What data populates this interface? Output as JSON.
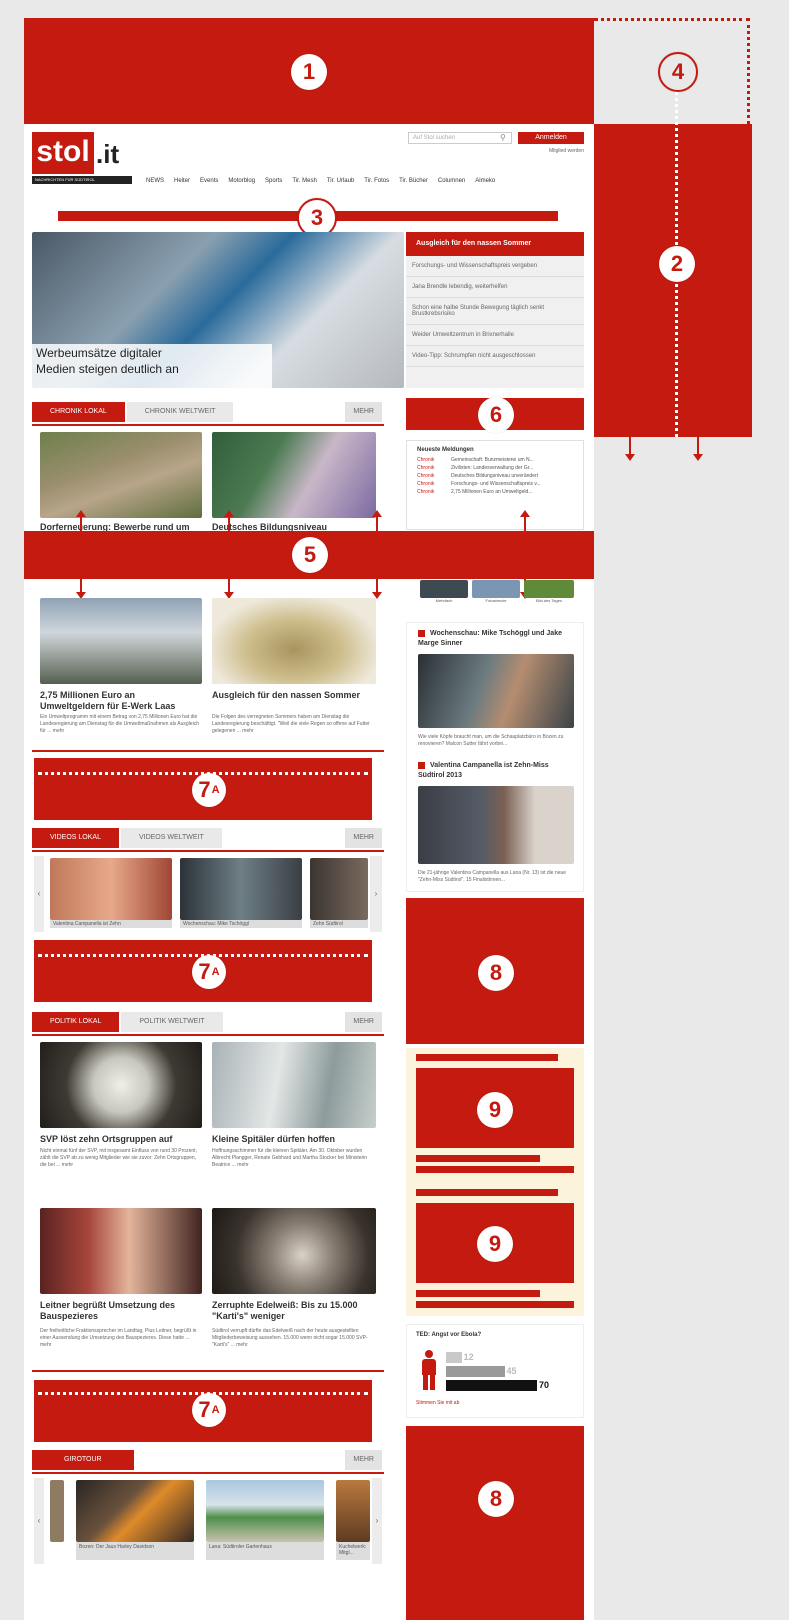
{
  "markers": {
    "m1": "1",
    "m2": "2",
    "m3": "3",
    "m4": "4",
    "m5": "5",
    "m6": "6",
    "m7a": "7",
    "m7a_sub": "A",
    "m8": "8",
    "m9": "9"
  },
  "logo": {
    "brand": "stol",
    "tld": ".it",
    "tagline": "NACHRICHTEN FÜR SÜDTIROL"
  },
  "header": {
    "search_placeholder": "Auf Stol suchen",
    "login_label": "Anmelden",
    "sub_link": "Mitglied werden"
  },
  "nav": [
    "NEWS",
    "Heiter",
    "Events",
    "Motorblog",
    "Sports",
    "Tir. Mesh",
    "Tir. Urlaub",
    "Tir. Fotos",
    "Tir. Bücher",
    "Columnen",
    "Almeko"
  ],
  "hero": {
    "caption_line1": "Werbeumsätze digitaler",
    "caption_line2": "Medien steigen deutlich an",
    "side_title": "Ausgleich für den nassen Sommer",
    "side_items": [
      "Forschungs- und Wissenschaftspreis vergeben",
      "Jana Brendle lebendig, weiterhelfen",
      "Schon eine halbe Stunde Bewegung täglich senkt Brustkrebsrisiko",
      "Weider Umweltzentrum in Brixnerhalle",
      "Video-Tipp: Schrumpfen nicht ausgeschlossen"
    ]
  },
  "section_chronik": {
    "tab_active": "CHRONIK LOKAL",
    "tab_inactive": "CHRONIK WELTWEIT",
    "more": "MEHR",
    "items": [
      {
        "headline": "Dorferneuerung: Bewerbe rund um",
        "teaser": ""
      },
      {
        "headline": "Deutsches Bildungsniveau unverändert",
        "teaser": ""
      },
      {
        "headline": "2,75 Millionen Euro an Umweltgeldern für E-Werk Laas",
        "teaser": "Ein Umweltprogramm mit einem Betrag von 2,75 Millionen Euro hat die Landesregierung am Dienstag für die Umweltmaßnahmen als Ausgleich für ... mehr"
      },
      {
        "headline": "Ausgleich für den nassen Sommer",
        "teaser": "Die Folgen des verregneten Sommers haben am Dienstag die Landesregierung beschäftigt. \"Weil die viele Regen so offene auf Futter gelegenen ... mehr"
      }
    ]
  },
  "latest": {
    "title": "Neueste Meldungen",
    "rows": [
      {
        "cat": "Chronik",
        "text": "Gemeinschaft: Bunzmeisterei um N..."
      },
      {
        "cat": "Chronik",
        "text": "Zivilisten: Landesverwaltung der Gr..."
      },
      {
        "cat": "Chronik",
        "text": "Deutsches Bildungsniveau unverändert"
      },
      {
        "cat": "Chronik",
        "text": "Forschungs- und Wissenschaftspreis v..."
      },
      {
        "cat": "Chronik",
        "text": "2,75 Millionen Euro an Umweltgeld..."
      }
    ],
    "thumbs": [
      "Mehrfach",
      "Fotostrecke",
      "Bild des Tages"
    ]
  },
  "videos_sidebar": [
    {
      "title": "Wochenschau: Mike Tschöggl und Jake Marge Sinner",
      "teaser": "Wie viele Köpfe braucht man, um die Schauplatzbüro in Bozen zu renovieren? Malcon Sutter fährt vorbei..."
    },
    {
      "title": "Valentina Campanella ist Zehn-Miss Südtirol 2013",
      "teaser": "Die 21-jährige Valentina Campanella aus Lana (Nr. 13) ist die neue \"Zehn-Miss Südtirol\". 15 Finalistinnen..."
    }
  ],
  "section_videos": {
    "tab_active": "VIDEOS LOKAL",
    "tab_inactive": "VIDEOS WELTWEIT",
    "more": "MEHR",
    "items": [
      "Valentina Campanella ist Zehn",
      "Wochenschau: Mike Tschöggl",
      "Zehn Südtirol"
    ]
  },
  "section_politik": {
    "tab_active": "POLITIK LOKAL",
    "tab_inactive": "POLITIK WELTWEIT",
    "more": "MEHR",
    "items": [
      {
        "headline": "SVP löst zehn Ortsgruppen auf",
        "teaser": "Nicht einmal fünf der SVP, mit insgesamt Einfluss von rund 30 Prozent, zählt die SVP ab zu wenig Mitglieder wie sie zuvor: Zehn Ortsgruppen, die bei ... mehr"
      },
      {
        "headline": "Kleine Spitäler dürfen hoffen",
        "teaser": "Hoffnungsschimmer für die kleinen Spitäler. Am 30. Oktober wurden Albrecht Plangger, Renate Gebhard und Martha Stocker bei Ministerin Beatrice ... mehr"
      },
      {
        "headline": "Leitner begrüßt Umsetzung des Bauspezieres",
        "teaser": "Der freiheitliche Fraktionssprecher im Landtag, Pius Leitner, begrüßt in einer Aussendung die Umsetzung des Bauspezieres. Diese hatte ... mehr"
      },
      {
        "headline": "Zerruphte Edelweiß: Bis zu 15.000 \"Karti's\" weniger",
        "teaser": "Südtirol verrupft dürfte das Edelweiß nach der heute ausgestellten Mitgliederbeweisung aussehen. 15.000 wenn nicht sogar 15.000 SVP-\"Karti's\" ... mehr"
      }
    ]
  },
  "poll": {
    "title": "TED: Angst vor Ebola?",
    "values": [
      12,
      45,
      70
    ],
    "link": "Stimmen Sie mit ab"
  },
  "section_giro": {
    "tab_active": "GIROTOUR",
    "more": "MEHR",
    "items": [
      "Bozen: Der Jaus Harley Davidson",
      "Lana: Südtiroler Gartenhaus",
      "Kuchelwerk: Mitgl..."
    ]
  },
  "colors": {
    "accent": "#c41a0f",
    "background": "#e9e9e9"
  }
}
